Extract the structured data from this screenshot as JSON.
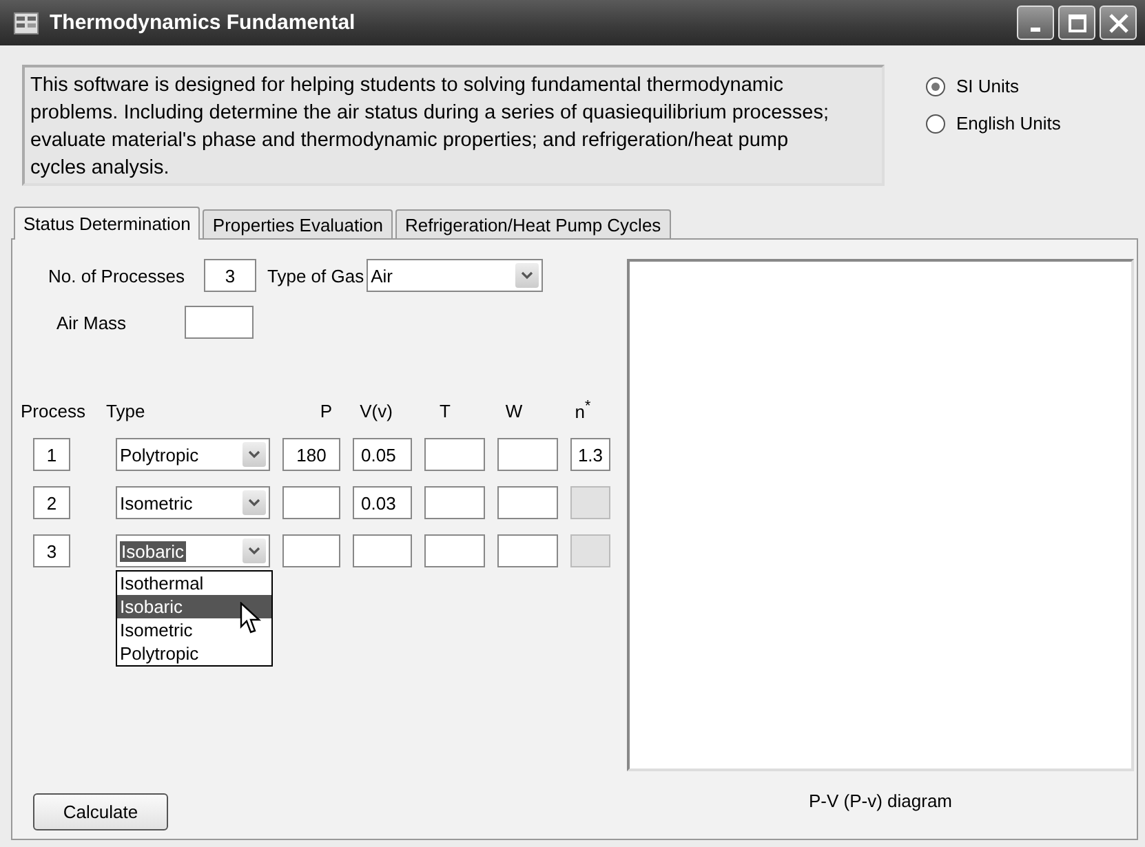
{
  "window": {
    "title": "Thermodynamics Fundamental"
  },
  "description": "This software is designed for helping students to solving fundamental thermodynamic problems. Including determine the air status during a series of quasiequilibrium processes; evaluate material's phase and thermodynamic properties; and refrigeration/heat pump cycles analysis.",
  "units": [
    {
      "label": "SI Units",
      "selected": true
    },
    {
      "label": "English Units",
      "selected": false
    }
  ],
  "tabs": [
    {
      "label": "Status Determination",
      "selected": true
    },
    {
      "label": "Properties Evaluation",
      "selected": false
    },
    {
      "label": "Refrigeration/Heat Pump Cycles",
      "selected": false
    }
  ],
  "form": {
    "processes_label": "No. of Processes",
    "processes_value": "3",
    "gas_label": "Type of Gas",
    "gas_value": "Air",
    "mass_label": "Air Mass"
  },
  "table": {
    "columns": [
      "Process",
      "Type",
      "P",
      "V(v)",
      "T",
      "W",
      "n$^{*}$"
    ],
    "rows": [
      {
        "process": "1",
        "type": "Polytropic",
        "p": "180",
        "v": "0.05",
        "n": "1.3",
        "n_disabled": false,
        "expanded": false
      },
      {
        "process": "2",
        "type": "Isometric",
        "v": "0.03",
        "n_disabled": true,
        "expanded": false
      },
      {
        "process": "3",
        "type": "Isobaric",
        "n_disabled": true,
        "expanded": true
      }
    ]
  },
  "dropdown": {
    "options": [
      {
        "label": "Isothermal",
        "selected": false
      },
      {
        "label": "Isobaric",
        "selected": true
      },
      {
        "label": "Isometric",
        "selected": false
      },
      {
        "label": "Polytropic",
        "selected": false
      }
    ]
  },
  "diagram": {
    "caption": "P-V (P-v) diagram"
  },
  "buttons": [
    {
      "label": "Calculate"
    }
  ]
}
